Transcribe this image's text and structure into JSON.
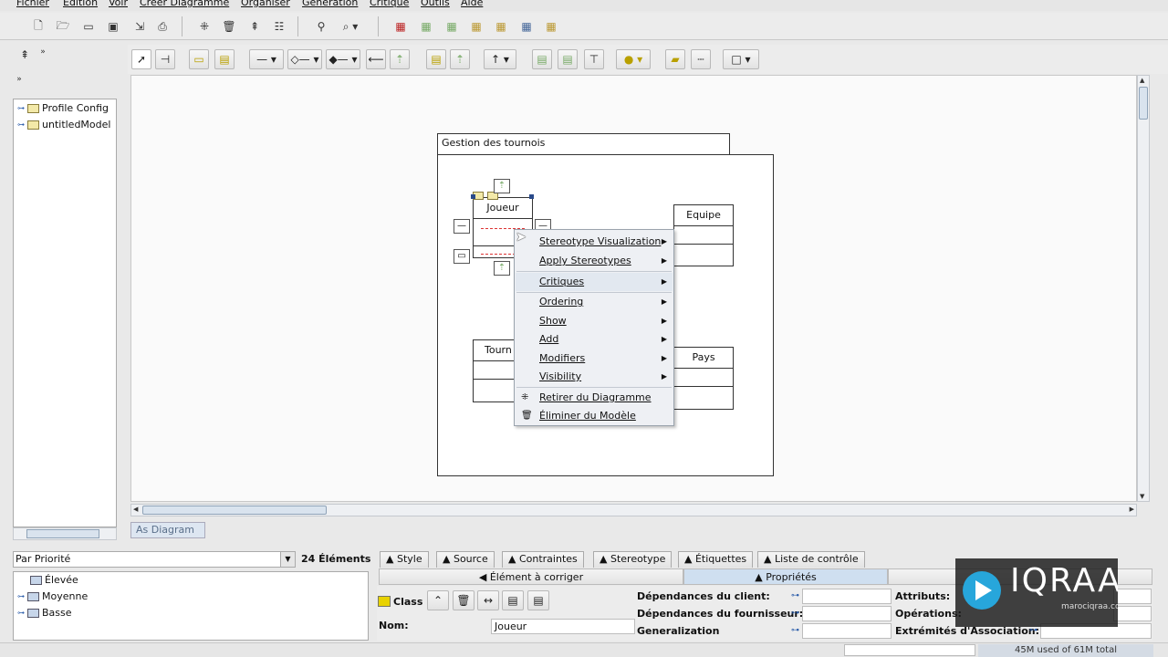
{
  "menubar": {
    "items": [
      "Fichier",
      "Edition",
      "Voir",
      "Créer Diagramme",
      "Organiser",
      "Génération",
      "Critique",
      "Outils",
      "Aide"
    ]
  },
  "explorer": {
    "tree": [
      {
        "label": "Profile Config"
      },
      {
        "label": "untitledModel"
      }
    ]
  },
  "diagram": {
    "tab_label": "As Diagram",
    "package_name": "Gestion des tournois",
    "classes": {
      "joueur": "Joueur",
      "equipe": "Equipe",
      "tournoi": "Tourn",
      "pays": "Pays"
    }
  },
  "context_menu": {
    "items": [
      {
        "label": "Stereotype Visualization",
        "submenu": true
      },
      {
        "label": "Apply Stereotypes",
        "submenu": true
      },
      {
        "label": "Critiques",
        "submenu": true
      },
      {
        "label": "Ordering",
        "submenu": true
      },
      {
        "label": "Show",
        "submenu": true
      },
      {
        "label": "Add",
        "submenu": true
      },
      {
        "label": "Modifiers",
        "submenu": true
      },
      {
        "label": "Visibility",
        "submenu": true
      },
      {
        "label": "Retirer du Diagramme",
        "submenu": false
      },
      {
        "label": "Éliminer du Modèle",
        "submenu": false
      }
    ]
  },
  "todo": {
    "sort_label": "Par Priorité",
    "count_label": "24 Éléments",
    "items": [
      "Élevée",
      "Moyenne",
      "Basse"
    ]
  },
  "details": {
    "tabs": [
      "Style",
      "Source",
      "Contraintes",
      "Stereotype",
      "Étiquettes",
      "Liste de contrôle"
    ],
    "todo_tab": "Élément à corriger",
    "props_tab": "Propriétés",
    "element_type": "Class",
    "name_label": "Nom:",
    "name_value": "Joueur",
    "client_deps_label": "Dépendances du client:",
    "supplier_deps_label": "Dépendances du fournisseur:",
    "generalization_label": "Generalization",
    "attributes_label": "Attributs:",
    "operations_label": "Opérations:",
    "assoc_ends_label": "Extrémités d'Association:"
  },
  "status": {
    "memory": "45M used of 61M total"
  },
  "watermark": {
    "brand": "IQRAA",
    "site": "marociqraa.com"
  }
}
